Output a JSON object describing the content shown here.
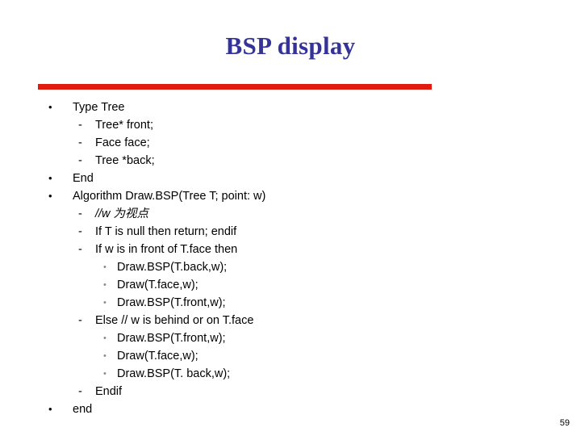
{
  "slide": {
    "title": "BSP display",
    "title_color": "#333399",
    "rule_color": "#e01b10",
    "background_color": "#ffffff",
    "page_number": "59"
  },
  "markers": {
    "level1": "•",
    "level2": "-",
    "level3": "•"
  },
  "content": {
    "lines": [
      {
        "level": 1,
        "text": "Type Tree"
      },
      {
        "level": 2,
        "text": "Tree* front;"
      },
      {
        "level": 2,
        "text": "Face face;"
      },
      {
        "level": 2,
        "text": "Tree *back;"
      },
      {
        "level": 1,
        "text": "End"
      },
      {
        "level": 1,
        "text": "Algorithm Draw.BSP(Tree T; point: w)"
      },
      {
        "level": 2,
        "text": "//w 为视点",
        "italic": true
      },
      {
        "level": 2,
        "text": "If T is null then return; endif"
      },
      {
        "level": 2,
        "text": "If w is in front of T.face then"
      },
      {
        "level": 3,
        "text": "Draw.BSP(T.back,w);"
      },
      {
        "level": 3,
        "text": "Draw(T.face,w);"
      },
      {
        "level": 3,
        "text": "Draw.BSP(T.front,w);"
      },
      {
        "level": 2,
        "text": "Else // w is behind or on T.face"
      },
      {
        "level": 3,
        "text": " Draw.BSP(T.front,w);"
      },
      {
        "level": 3,
        "text": "Draw(T.face,w);"
      },
      {
        "level": 3,
        "text": "Draw.BSP(T. back,w);"
      },
      {
        "level": 2,
        "text": "Endif"
      },
      {
        "level": 1,
        "text": "end"
      }
    ]
  }
}
